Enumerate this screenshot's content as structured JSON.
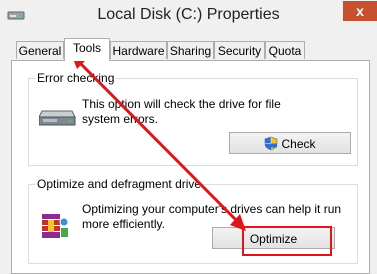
{
  "window": {
    "title": "Local Disk (C:) Properties",
    "close_glyph": "x",
    "icon": "drive-icon"
  },
  "tabs": [
    {
      "label": "General"
    },
    {
      "label": "Tools",
      "active": true
    },
    {
      "label": "Hardware"
    },
    {
      "label": "Sharing"
    },
    {
      "label": "Security"
    },
    {
      "label": "Quota"
    }
  ],
  "error_checking": {
    "title": "Error checking",
    "description_line1": "This option will check the drive for file",
    "description_line2": "system errors.",
    "button_label": "Check",
    "icon": "hard-drive-icon",
    "button_icon": "uac-shield-icon"
  },
  "optimize": {
    "title": "Optimize and defragment drive",
    "description_line1": "Optimizing your computer's drives can help it run",
    "description_line2": "more efficiently.",
    "button_label": "Optimize",
    "icon": "defrag-icon"
  },
  "annotation": {
    "arrow_color": "#e0151b"
  }
}
